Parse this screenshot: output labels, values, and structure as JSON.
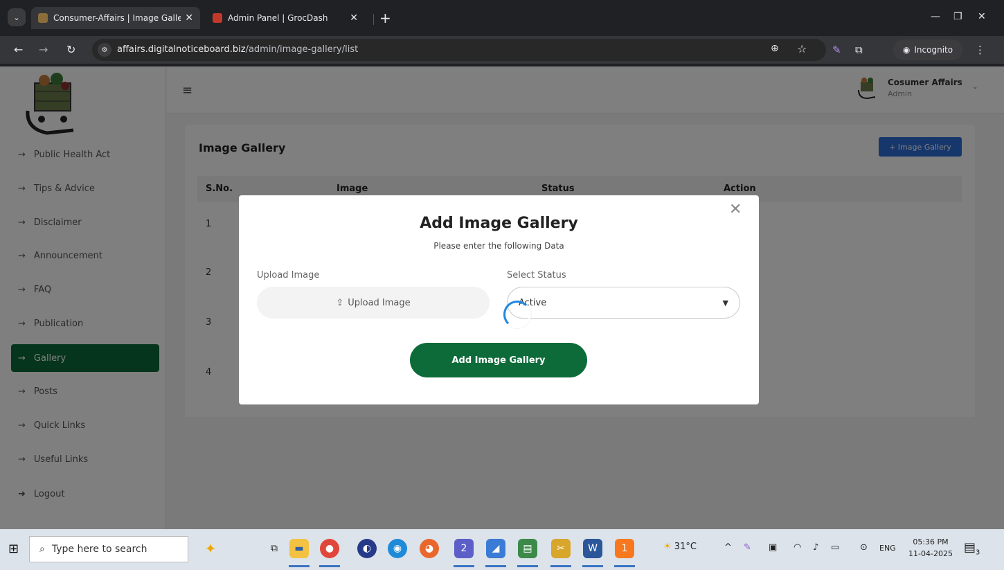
{
  "browser": {
    "tabs": [
      {
        "title": "Consumer-Affairs | Image Galle",
        "active": true
      },
      {
        "title": "Admin Panel | GrocDash",
        "active": false
      }
    ],
    "url_host": "affairs.digitalnoticeboard.biz",
    "url_path": "/admin/image-gallery/list",
    "incognito_label": "Incognito"
  },
  "sidebar": {
    "items": [
      {
        "label": "Public Health Act",
        "active": false
      },
      {
        "label": "Tips & Advice",
        "active": false
      },
      {
        "label": "Disclaimer",
        "active": false
      },
      {
        "label": "Announcement",
        "active": false
      },
      {
        "label": "FAQ",
        "active": false
      },
      {
        "label": "Publication",
        "active": false
      },
      {
        "label": "Gallery",
        "active": true
      },
      {
        "label": "Posts",
        "active": false
      },
      {
        "label": "Quick Links",
        "active": false
      },
      {
        "label": "Useful Links",
        "active": false
      }
    ],
    "logout_label": "Logout"
  },
  "header": {
    "user_name": "Cosumer Affairs",
    "user_role": "Admin"
  },
  "page": {
    "title": "Image Gallery",
    "add_button": "+ Image Gallery",
    "columns": [
      "S.No.",
      "Image",
      "Status",
      "Action"
    ],
    "rows": [
      "1",
      "2",
      "3",
      "4"
    ]
  },
  "modal": {
    "title": "Add Image Gallery",
    "subtitle": "Please enter the following Data",
    "upload_label": "Upload Image",
    "upload_button": "Upload Image",
    "status_label": "Select Status",
    "status_value": "Active",
    "submit_label": "Add Image Gallery"
  },
  "taskbar": {
    "search_placeholder": "Type here to search",
    "weather": "31°C",
    "language": "ENG",
    "time": "05:36 PM",
    "date": "11-04-2025",
    "notifications": "3",
    "teams_badge": "2",
    "skype_badge": "1"
  },
  "colors": {
    "primary_green": "#0d6b3a",
    "accent_blue": "#2d6ed8"
  }
}
